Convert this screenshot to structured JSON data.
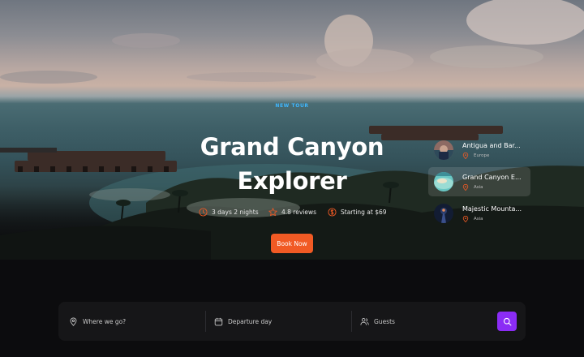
{
  "hero": {
    "tag": "NEW TOUR",
    "title_line1": "Grand Canyon",
    "title_line2": "Explorer",
    "meta": [
      {
        "icon": "clock-icon",
        "text": "3 days 2 nights"
      },
      {
        "icon": "star-icon",
        "text": "4.8 reviews"
      },
      {
        "icon": "dollar-icon",
        "text": "Starting at $69"
      }
    ],
    "book_label": "Book Now"
  },
  "tours": [
    {
      "name": "Antigua and Bar...",
      "location": "Europe",
      "active": false
    },
    {
      "name": "Grand Canyon E...",
      "location": "Asia",
      "active": true
    },
    {
      "name": "Majestic Mounta...",
      "location": "Asia",
      "active": false
    }
  ],
  "search": {
    "destination_placeholder": "Where we go?",
    "date_placeholder": "Departure day",
    "guests_placeholder": "Guests"
  },
  "colors": {
    "accent_orange": "#f15a24",
    "accent_purple": "#8b2cf5",
    "tag_blue": "#3fb7ff"
  }
}
